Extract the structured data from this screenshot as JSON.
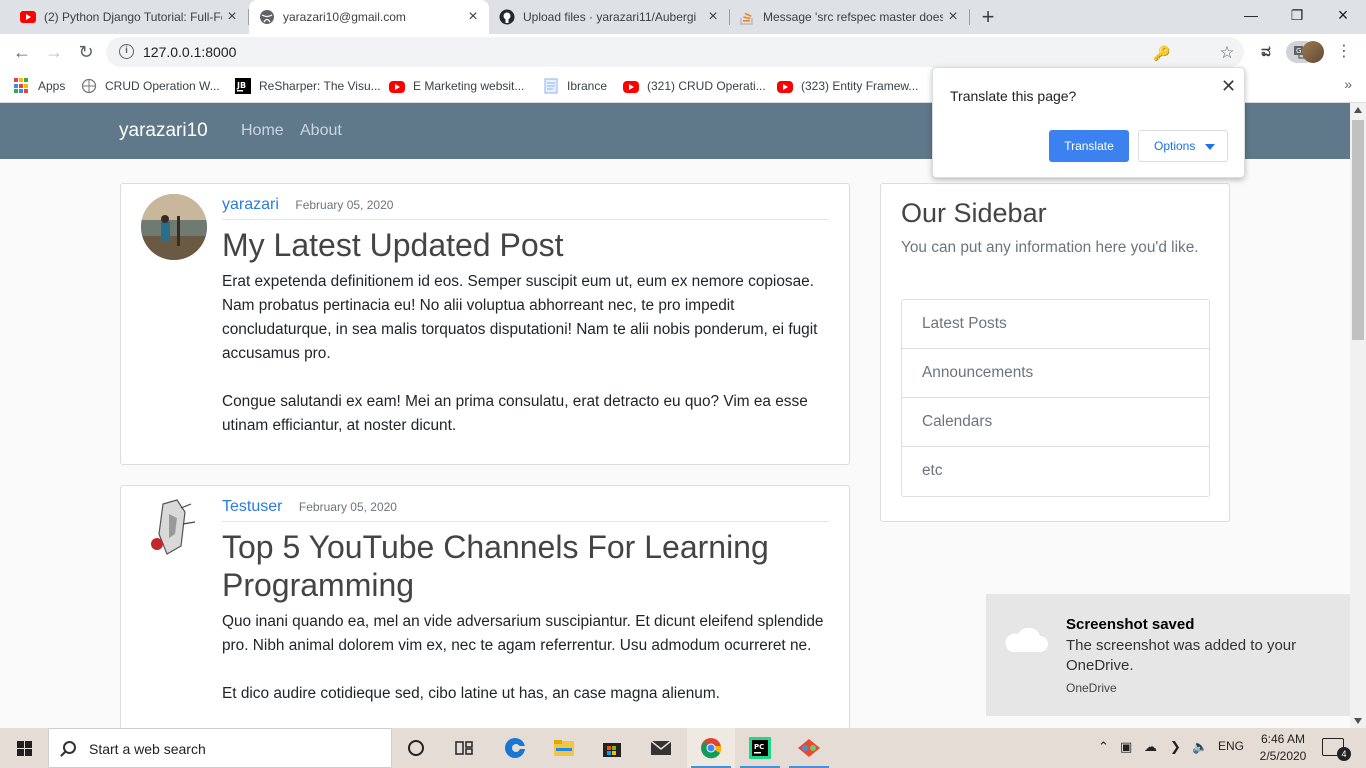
{
  "browser": {
    "tabs": [
      {
        "title": "(2) Python Django Tutorial: Full-Fe",
        "icon": "youtube-icon"
      },
      {
        "title": "yarazari10@gmail.com",
        "icon": "globe-icon"
      },
      {
        "title": "Upload files · yarazari11/Aubergi",
        "icon": "github-icon"
      },
      {
        "title": "Message 'src refspec master does",
        "icon": "stackoverflow-icon"
      }
    ],
    "address": "127.0.0.1:8000",
    "bookmarks": [
      {
        "label": "Apps",
        "icon": "apps-icon"
      },
      {
        "label": "CRUD Operation W...",
        "icon": "globe-icon"
      },
      {
        "label": "ReSharper: The Visu...",
        "icon": "jetbrains-icon"
      },
      {
        "label": "E Marketing websit...",
        "icon": "youtube-icon"
      },
      {
        "label": "Ibrance",
        "icon": "document-icon"
      },
      {
        "label": "(321) CRUD Operati...",
        "icon": "youtube-icon"
      },
      {
        "label": "(323) Entity Framew...",
        "icon": "youtube-icon"
      }
    ]
  },
  "translate": {
    "question": "Translate this page?",
    "translate_label": "Translate",
    "options_label": "Options",
    "accent": "#3b82f0"
  },
  "site": {
    "brand": "yarazari10",
    "nav": [
      "Home",
      "About"
    ],
    "nav_color": "#5f788a"
  },
  "posts": [
    {
      "author": "yarazari",
      "date": "February 05, 2020",
      "title": "My Latest Updated Post",
      "paragraphs": [
        "Erat expetenda definitionem id eos. Semper suscipit eum ut, eum ex nemore copiosae. Nam probatus pertinacia eu! No alii voluptua abhorreant nec, te pro impedit concludaturque, in sea malis torquatos disputationi! Nam te alii nobis ponderum, ei fugit accusamus pro.",
        "Congue salutandi ex eam! Mei an prima consulatu, erat detracto eu quo? Vim ea esse utinam efficiantur, at noster dicunt."
      ]
    },
    {
      "author": "Testuser",
      "date": "February 05, 2020",
      "title": "Top 5 YouTube Channels For Learning Programming",
      "paragraphs": [
        "Quo inani quando ea, mel an vide adversarium suscipiantur. Et dicunt eleifend splendide pro. Nibh animal dolorem vim ex, nec te agam referrentur. Usu admodum ocurreret ne.",
        "Et dico audire cotidieque sed, cibo latine ut has, an case magna alienum."
      ]
    }
  ],
  "sidebar": {
    "title": "Our Sidebar",
    "subtitle": "You can put any information here you'd like.",
    "items": [
      "Latest Posts",
      "Announcements",
      "Calendars",
      "etc"
    ]
  },
  "toast": {
    "title": "Screenshot saved",
    "message": "The screenshot was added to your OneDrive.",
    "source": "OneDrive"
  },
  "taskbar": {
    "search_placeholder": "Start a web search",
    "language": "ENG",
    "time": "6:46 AM",
    "date": "2/5/2020",
    "notifications": "4"
  }
}
